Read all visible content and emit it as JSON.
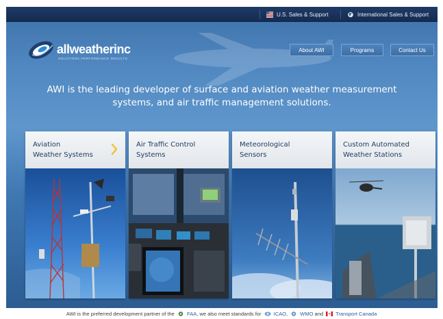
{
  "topbar": {
    "us_sales": "U.S. Sales & Support",
    "intl_sales": "International Sales & Support"
  },
  "logo": {
    "name": "allweatherinc",
    "tagline": "SOLUTIONS  PERFORMANCE  RESULTS"
  },
  "nav": {
    "about": "About AWI",
    "programs": "Programs",
    "contact": "Contact Us"
  },
  "headline": "AWI is the leading developer of surface and aviation weather measurement systems, and air traffic management solutions.",
  "cards": [
    {
      "title": "Aviation\nWeather Systems",
      "has_arrow": true
    },
    {
      "title": "Air Traffic Control\nSystems",
      "has_arrow": false
    },
    {
      "title": "Meteorological\nSensors",
      "has_arrow": false
    },
    {
      "title": "Custom Automated\nWeather Stations",
      "has_arrow": false
    }
  ],
  "footer": {
    "prefix": "AWI is the preferred development partner of the",
    "faa": "FAA",
    "middle": ", we also meet standards for",
    "icao": "ICAO",
    "sep1": ",",
    "wmo": "WMO",
    "and": "and",
    "transport": "Transport Canada"
  },
  "colors": {
    "topbar": "#152c52",
    "page_blue": "#4f86bf",
    "card_title": "#1f3b63",
    "arrow": "#f2c12e"
  },
  "icons": [
    "us-flag-icon",
    "globe-icon",
    "awi-logo-icon",
    "chevron-right-icon",
    "faa-icon",
    "icao-icon",
    "wmo-icon",
    "canada-flag-icon"
  ]
}
